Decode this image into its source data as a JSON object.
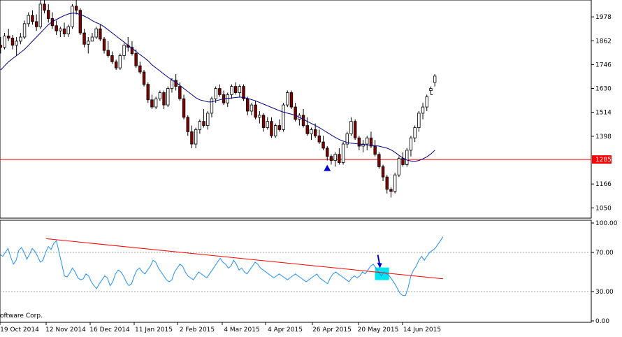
{
  "watermark": "oftware Corp.",
  "colors": {
    "background": "#ffffff",
    "bull": "#ffffff",
    "bear": "#800000",
    "candle_outline": "#000000",
    "ma": "#00008b",
    "support": "#ff0000",
    "rsi": "#1e90ff",
    "trendline": "#ff0000",
    "marker": "#0000cd",
    "highlight": "#00e5ee",
    "price_tag": "#ff0000"
  },
  "chart_data": [
    {
      "type": "candlestick",
      "title": "",
      "ylim": [
        1000,
        2060
      ],
      "yticks": [
        1978,
        1862,
        1746,
        1630,
        1514,
        1398,
        1166,
        1050
      ],
      "support_level": 1285,
      "support_label": "1285",
      "last_price": 1668,
      "markers": [
        {
          "type": "triangle-up",
          "at_index": 82
        }
      ],
      "ohlc": [
        [
          1840,
          1880,
          1800,
          1830
        ],
        [
          1830,
          1900,
          1820,
          1885
        ],
        [
          1885,
          1920,
          1860,
          1875
        ],
        [
          1875,
          1890,
          1820,
          1840
        ],
        [
          1840,
          1880,
          1790,
          1860
        ],
        [
          1860,
          1900,
          1845,
          1880
        ],
        [
          1880,
          1960,
          1870,
          1945
        ],
        [
          1945,
          2000,
          1930,
          1985
        ],
        [
          1985,
          2010,
          1940,
          1955
        ],
        [
          1955,
          1990,
          1910,
          1930
        ],
        [
          1930,
          2060,
          1920,
          2040
        ],
        [
          2040,
          2080,
          1995,
          2010
        ],
        [
          2010,
          2040,
          1950,
          1970
        ],
        [
          1970,
          2000,
          1920,
          1935
        ],
        [
          1935,
          1960,
          1890,
          1910
        ],
        [
          1910,
          1930,
          1880,
          1920
        ],
        [
          1920,
          1950,
          1880,
          1895
        ],
        [
          1895,
          1940,
          1880,
          1930
        ],
        [
          1930,
          2040,
          1920,
          2030
        ],
        [
          2030,
          2070,
          1990,
          2010
        ],
        [
          2010,
          2020,
          1890,
          1900
        ],
        [
          1900,
          1920,
          1830,
          1845
        ],
        [
          1845,
          1880,
          1800,
          1860
        ],
        [
          1860,
          1900,
          1860,
          1880
        ],
        [
          1880,
          1930,
          1870,
          1920
        ],
        [
          1920,
          1940,
          1860,
          1870
        ],
        [
          1870,
          1880,
          1800,
          1815
        ],
        [
          1815,
          1860,
          1780,
          1790
        ],
        [
          1790,
          1810,
          1750,
          1760
        ],
        [
          1760,
          1770,
          1720,
          1730
        ],
        [
          1730,
          1800,
          1720,
          1790
        ],
        [
          1790,
          1850,
          1770,
          1840
        ],
        [
          1840,
          1880,
          1810,
          1830
        ],
        [
          1830,
          1860,
          1790,
          1800
        ],
        [
          1800,
          1820,
          1730,
          1740
        ],
        [
          1740,
          1760,
          1700,
          1710
        ],
        [
          1710,
          1720,
          1640,
          1650
        ],
        [
          1650,
          1660,
          1560,
          1575
        ],
        [
          1575,
          1600,
          1530,
          1540
        ],
        [
          1540,
          1590,
          1530,
          1580
        ],
        [
          1580,
          1620,
          1570,
          1610
        ],
        [
          1610,
          1620,
          1530,
          1550
        ],
        [
          1550,
          1640,
          1540,
          1630
        ],
        [
          1630,
          1680,
          1610,
          1670
        ],
        [
          1670,
          1700,
          1620,
          1640
        ],
        [
          1640,
          1660,
          1570,
          1580
        ],
        [
          1580,
          1600,
          1480,
          1490
        ],
        [
          1490,
          1500,
          1400,
          1420
        ],
        [
          1420,
          1450,
          1340,
          1360
        ],
        [
          1360,
          1440,
          1340,
          1430
        ],
        [
          1430,
          1480,
          1410,
          1470
        ],
        [
          1470,
          1530,
          1440,
          1450
        ],
        [
          1450,
          1520,
          1430,
          1510
        ],
        [
          1510,
          1590,
          1490,
          1580
        ],
        [
          1580,
          1640,
          1560,
          1630
        ],
        [
          1630,
          1650,
          1590,
          1600
        ],
        [
          1600,
          1620,
          1550,
          1560
        ],
        [
          1560,
          1610,
          1540,
          1600
        ],
        [
          1600,
          1650,
          1580,
          1640
        ],
        [
          1640,
          1660,
          1600,
          1610
        ],
        [
          1610,
          1650,
          1590,
          1640
        ],
        [
          1640,
          1650,
          1570,
          1580
        ],
        [
          1580,
          1590,
          1500,
          1520
        ],
        [
          1520,
          1560,
          1500,
          1550
        ],
        [
          1550,
          1570,
          1480,
          1490
        ],
        [
          1490,
          1520,
          1460,
          1500
        ],
        [
          1500,
          1510,
          1420,
          1440
        ],
        [
          1440,
          1490,
          1430,
          1470
        ],
        [
          1470,
          1490,
          1390,
          1400
        ],
        [
          1400,
          1460,
          1390,
          1450
        ],
        [
          1450,
          1480,
          1420,
          1430
        ],
        [
          1430,
          1560,
          1420,
          1550
        ],
        [
          1550,
          1620,
          1540,
          1610
        ],
        [
          1610,
          1620,
          1530,
          1540
        ],
        [
          1540,
          1560,
          1470,
          1480
        ],
        [
          1480,
          1510,
          1450,
          1500
        ],
        [
          1500,
          1530,
          1440,
          1450
        ],
        [
          1450,
          1490,
          1400,
          1410
        ],
        [
          1410,
          1440,
          1380,
          1430
        ],
        [
          1430,
          1460,
          1390,
          1400
        ],
        [
          1400,
          1430,
          1360,
          1370
        ],
        [
          1370,
          1400,
          1330,
          1340
        ],
        [
          1340,
          1350,
          1280,
          1300
        ],
        [
          1300,
          1310,
          1260,
          1280
        ],
        [
          1280,
          1320,
          1250,
          1310
        ],
        [
          1310,
          1340,
          1260,
          1270
        ],
        [
          1270,
          1370,
          1260,
          1360
        ],
        [
          1360,
          1420,
          1340,
          1410
        ],
        [
          1410,
          1490,
          1400,
          1470
        ],
        [
          1470,
          1480,
          1380,
          1390
        ],
        [
          1390,
          1400,
          1330,
          1350
        ],
        [
          1350,
          1380,
          1320,
          1360
        ],
        [
          1360,
          1400,
          1330,
          1390
        ],
        [
          1390,
          1420,
          1340,
          1350
        ],
        [
          1350,
          1380,
          1300,
          1310
        ],
        [
          1310,
          1320,
          1240,
          1250
        ],
        [
          1250,
          1260,
          1180,
          1200
        ],
        [
          1200,
          1210,
          1120,
          1140
        ],
        [
          1140,
          1150,
          1100,
          1130
        ],
        [
          1130,
          1220,
          1120,
          1210
        ],
        [
          1210,
          1300,
          1200,
          1290
        ],
        [
          1290,
          1320,
          1250,
          1260
        ],
        [
          1260,
          1340,
          1250,
          1330
        ],
        [
          1330,
          1400,
          1300,
          1390
        ],
        [
          1390,
          1450,
          1370,
          1440
        ],
        [
          1440,
          1520,
          1420,
          1510
        ],
        [
          1510,
          1560,
          1480,
          1540
        ],
        [
          1540,
          1600,
          1520,
          1590
        ],
        [
          1620,
          1640,
          1600,
          1630
        ],
        [
          1660,
          1700,
          1640,
          1690
        ]
      ],
      "ma": [
        1720,
        1740,
        1760,
        1775,
        1790,
        1805,
        1820,
        1840,
        1860,
        1880,
        1900,
        1920,
        1940,
        1955,
        1965,
        1975,
        1985,
        1992,
        1996,
        1995,
        1990,
        1982,
        1972,
        1960,
        1950,
        1942,
        1930,
        1915,
        1900,
        1885,
        1870,
        1855,
        1840,
        1825,
        1810,
        1795,
        1780,
        1765,
        1745,
        1730,
        1715,
        1700,
        1685,
        1672,
        1660,
        1645,
        1630,
        1615,
        1600,
        1585,
        1575,
        1570,
        1565,
        1565,
        1570,
        1575,
        1580,
        1582,
        1584,
        1586,
        1588,
        1586,
        1582,
        1576,
        1570,
        1562,
        1554,
        1546,
        1538,
        1530,
        1522,
        1515,
        1510,
        1505,
        1500,
        1490,
        1480,
        1470,
        1460,
        1450,
        1440,
        1428,
        1416,
        1404,
        1392,
        1382,
        1374,
        1368,
        1364,
        1362,
        1360,
        1358,
        1356,
        1354,
        1352,
        1350,
        1345,
        1340,
        1332,
        1320,
        1305,
        1292,
        1282,
        1278,
        1276,
        1280,
        1288,
        1298,
        1312,
        1330
      ]
    },
    {
      "type": "line",
      "title": "",
      "ylim": [
        0,
        100
      ],
      "yticks": [
        "100.00",
        "70.00",
        "30.00",
        "0.00"
      ],
      "dotted_levels": [
        70,
        30
      ],
      "values": [
        68,
        66,
        70,
        74,
        65,
        58,
        62,
        72,
        75,
        70,
        63,
        68,
        74,
        71,
        66,
        60,
        62,
        70,
        76,
        73,
        79,
        82,
        70,
        58,
        46,
        45,
        49,
        54,
        50,
        44,
        42,
        43,
        48,
        46,
        40,
        36,
        33,
        38,
        42,
        46,
        44,
        36,
        40,
        48,
        52,
        50,
        46,
        40,
        36,
        38,
        46,
        52,
        54,
        50,
        48,
        52,
        56,
        62,
        60,
        54,
        50,
        46,
        42,
        40,
        42,
        50,
        54,
        58,
        56,
        50,
        46,
        44,
        42,
        46,
        50,
        48,
        46,
        44,
        48,
        52,
        56,
        60,
        64,
        60,
        58,
        54,
        56,
        62,
        58,
        52,
        54,
        50,
        48,
        52,
        56,
        60,
        58,
        54,
        52,
        50,
        48,
        46,
        44,
        46,
        48,
        46,
        44,
        42,
        44,
        46,
        48,
        46,
        44,
        42,
        40,
        42,
        44,
        46,
        48,
        44,
        42,
        40,
        38,
        44,
        48,
        50,
        48,
        46,
        44,
        42,
        40,
        44,
        46,
        44,
        46,
        50,
        48,
        52,
        56,
        58,
        54,
        50,
        46,
        50,
        48,
        46,
        42,
        38,
        33,
        28,
        26,
        26,
        34,
        46,
        52,
        56,
        62,
        66,
        62,
        66,
        70,
        72,
        74,
        78,
        82,
        86
      ],
      "trendline": [
        [
          0,
          84
        ],
        [
          1,
          43
        ]
      ],
      "highlight_index": 142,
      "arrow_index": 142
    }
  ],
  "x_axis": {
    "labels": [
      "19 Oct 2014",
      "12 Nov 2014",
      "16 Dec 2014",
      "11 Jan 2015",
      "2 Feb 2015",
      "4 Mar 2015",
      "4 Apr 2015",
      "26 Apr 2015",
      "20 May 2015",
      "14 Jun 2015"
    ]
  }
}
